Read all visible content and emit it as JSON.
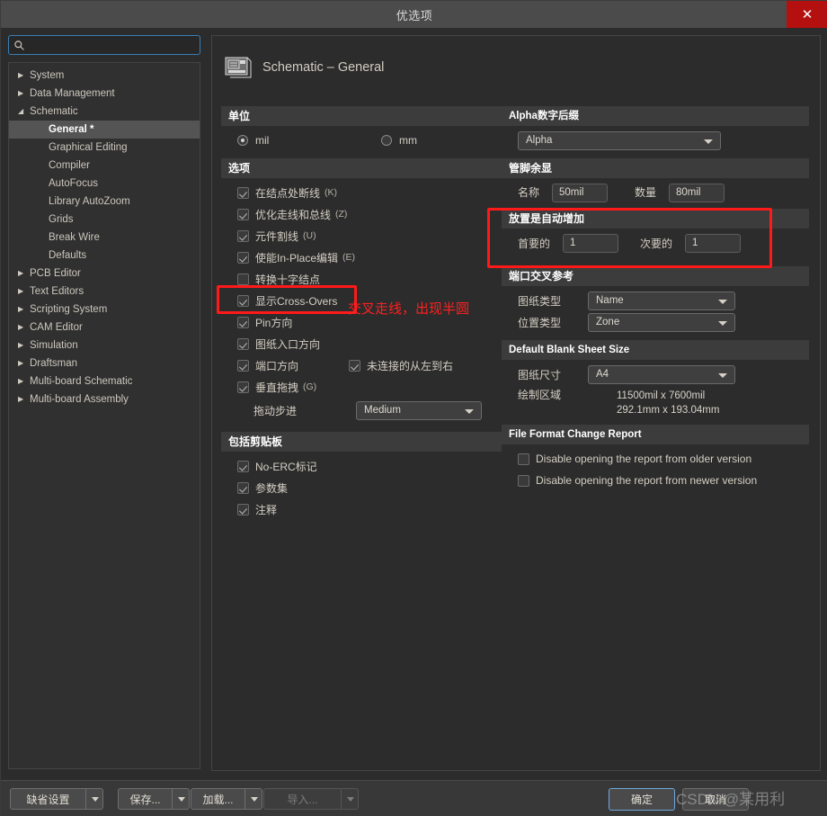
{
  "window": {
    "title": "优选项",
    "close_label": "✕"
  },
  "sidebar": {
    "search_placeholder": "",
    "search_value": "",
    "search_icon": "search-icon",
    "items": [
      {
        "label": "System",
        "level": 0,
        "arrow": "▶",
        "selected": false
      },
      {
        "label": "Data Management",
        "level": 0,
        "arrow": "▶",
        "selected": false
      },
      {
        "label": "Schematic",
        "level": 0,
        "arrow": "◢",
        "selected": false
      },
      {
        "label": "General *",
        "level": 1,
        "arrow": "",
        "selected": true
      },
      {
        "label": "Graphical Editing",
        "level": 1,
        "arrow": "",
        "selected": false
      },
      {
        "label": "Compiler",
        "level": 1,
        "arrow": "",
        "selected": false
      },
      {
        "label": "AutoFocus",
        "level": 1,
        "arrow": "",
        "selected": false
      },
      {
        "label": "Library AutoZoom",
        "level": 1,
        "arrow": "",
        "selected": false
      },
      {
        "label": "Grids",
        "level": 1,
        "arrow": "",
        "selected": false
      },
      {
        "label": "Break Wire",
        "level": 1,
        "arrow": "",
        "selected": false
      },
      {
        "label": "Defaults",
        "level": 1,
        "arrow": "",
        "selected": false
      },
      {
        "label": "PCB Editor",
        "level": 0,
        "arrow": "▶",
        "selected": false
      },
      {
        "label": "Text Editors",
        "level": 0,
        "arrow": "▶",
        "selected": false
      },
      {
        "label": "Scripting System",
        "level": 0,
        "arrow": "▶",
        "selected": false
      },
      {
        "label": "CAM Editor",
        "level": 0,
        "arrow": "▶",
        "selected": false
      },
      {
        "label": "Simulation",
        "level": 0,
        "arrow": "▶",
        "selected": false
      },
      {
        "label": "Draftsman",
        "level": 0,
        "arrow": "▶",
        "selected": false
      },
      {
        "label": "Multi-board Schematic",
        "level": 0,
        "arrow": "▶",
        "selected": false
      },
      {
        "label": "Multi-board Assembly",
        "level": 0,
        "arrow": "▶",
        "selected": false
      }
    ]
  },
  "page": {
    "title": "Schematic – General",
    "icon": "schematic-icon"
  },
  "units": {
    "header": "单位",
    "mil_label": "mil",
    "mm_label": "mm",
    "selected": "mil"
  },
  "options": {
    "header": "选项",
    "items": [
      {
        "label": "在结点处断线",
        "key": "(K)",
        "checked": true
      },
      {
        "label": "优化走线和总线",
        "key": "(Z)",
        "checked": true
      },
      {
        "label": "元件割线",
        "key": "(U)",
        "checked": true
      },
      {
        "label": "使能In-Place编辑",
        "key": "(E)",
        "checked": true
      },
      {
        "label": "转换十字结点",
        "key": "",
        "checked": false
      },
      {
        "label": "显示Cross-Overs",
        "key": "",
        "checked": true
      },
      {
        "label": "Pin方向",
        "key": "",
        "checked": true
      },
      {
        "label": "图纸入口方向",
        "key": "",
        "checked": true
      },
      {
        "label": "端口方向",
        "key": "",
        "checked": true
      },
      {
        "label": "垂直拖拽",
        "key": "(G)",
        "checked": true
      }
    ],
    "unconnected_label": "未连接的从左到右",
    "unconnected_checked": true,
    "drag_step_label": "拖动步进",
    "drag_step_value": "Medium"
  },
  "clipboard": {
    "header": "包括剪贴板",
    "items": [
      {
        "label": "No-ERC标记",
        "checked": true
      },
      {
        "label": "参数集",
        "checked": true
      },
      {
        "label": "注释",
        "checked": true
      }
    ]
  },
  "alpha": {
    "header": "Alpha数字后缀",
    "value": "Alpha"
  },
  "pin_margin": {
    "header": "管脚余显",
    "name_label": "名称",
    "name_value": "50mil",
    "number_label": "数量",
    "number_value": "80mil"
  },
  "auto_increment": {
    "header": "放置是自动增加",
    "primary_label": "首要的",
    "primary_value": "1",
    "secondary_label": "次要的",
    "secondary_value": "1"
  },
  "port_cross_ref": {
    "header": "端口交叉参考",
    "sheet_type_label": "图纸类型",
    "sheet_type_value": "Name",
    "location_type_label": "位置类型",
    "location_type_value": "Zone"
  },
  "blank_sheet": {
    "header": "Default Blank Sheet Size",
    "size_label": "图纸尺寸",
    "size_value": "A4",
    "draw_area_label": "绘制区域",
    "draw_area_mil": "11500mil x 7600mil",
    "draw_area_mm": "292.1mm x 193.04mm"
  },
  "file_format": {
    "header": "File Format Change Report",
    "items": [
      {
        "label": "Disable opening the report from older version",
        "checked": false
      },
      {
        "label": "Disable opening the report from newer version",
        "checked": false
      }
    ]
  },
  "annotations": {
    "note_text": "交叉走线，出现半圆",
    "color": "#ff2020"
  },
  "footer": {
    "defaults_label": "缺省设置",
    "save_label": "保存...",
    "load_label": "加载...",
    "import_label": "导入...",
    "ok_label": "确定",
    "cancel_label": "取消"
  },
  "watermark": {
    "text": "CSDN @某用利"
  }
}
